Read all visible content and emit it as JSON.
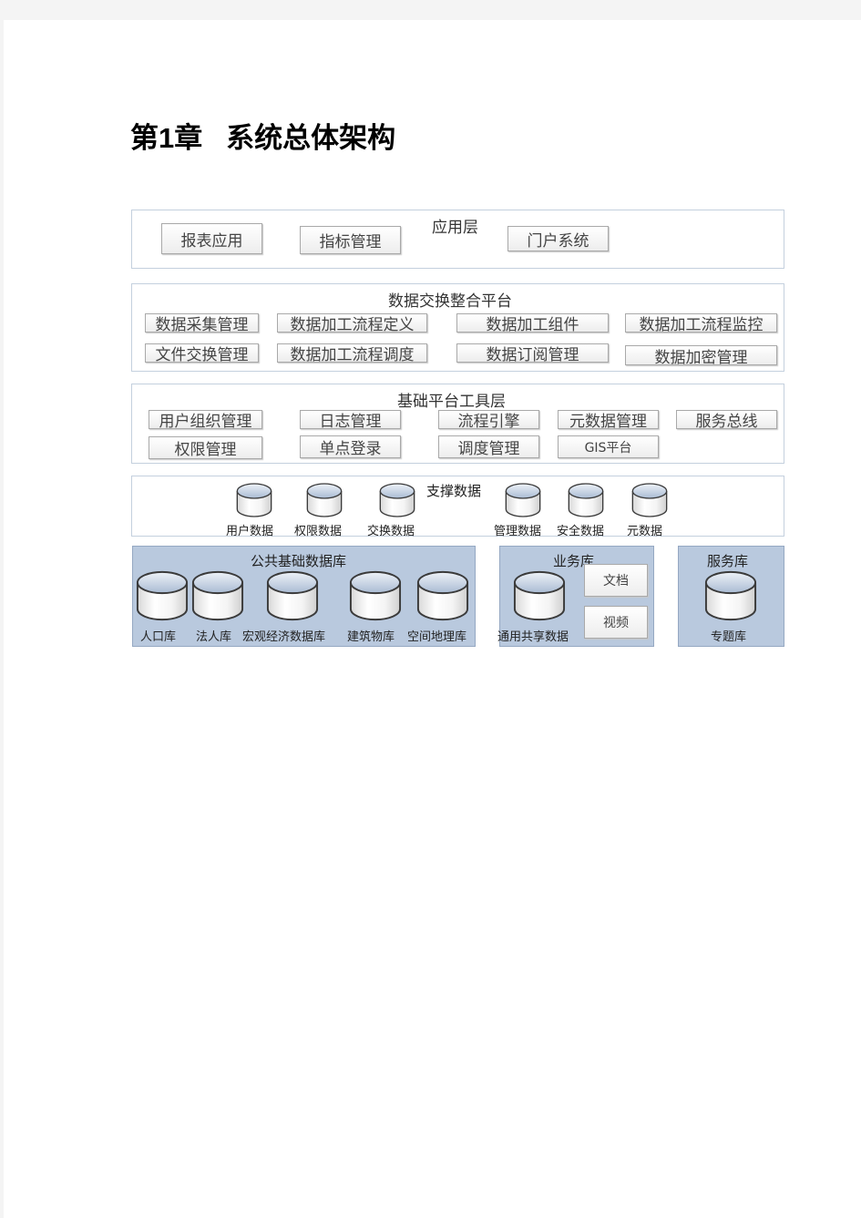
{
  "chapter": {
    "number_label": "第1章",
    "title": "系统总体架构"
  },
  "diagram": {
    "application_layer": {
      "title": "应用层",
      "items": [
        "报表应用",
        "指标管理",
        "门户系统"
      ]
    },
    "exchange_platform": {
      "title": "数据交换整合平台",
      "items": [
        "数据采集管理",
        "数据加工流程定义",
        "数据加工组件",
        "数据加工流程监控",
        "文件交换管理",
        "数据加工流程调度",
        "数据订阅管理",
        "数据加密管理"
      ]
    },
    "base_tools_layer": {
      "title": "基础平台工具层",
      "items": [
        "用户组织管理",
        "日志管理",
        "流程引擎",
        "元数据管理",
        "服务总线",
        "权限管理",
        "单点登录",
        "调度管理",
        "GIS平台"
      ]
    },
    "support_data": {
      "title": "支撑数据",
      "items": [
        "用户数据",
        "权限数据",
        "交换数据",
        "管理数据",
        "安全数据",
        "元数据"
      ]
    },
    "public_db": {
      "title": "公共基础数据库",
      "items": [
        "人口库",
        "法人库",
        "宏观经济数据库",
        "建筑物库",
        "空间地理库"
      ]
    },
    "business_db": {
      "title": "业务库",
      "database": "通用共享数据",
      "items": [
        "文档",
        "视频"
      ]
    },
    "service_db": {
      "title": "服务库",
      "database": "专题库"
    }
  }
}
